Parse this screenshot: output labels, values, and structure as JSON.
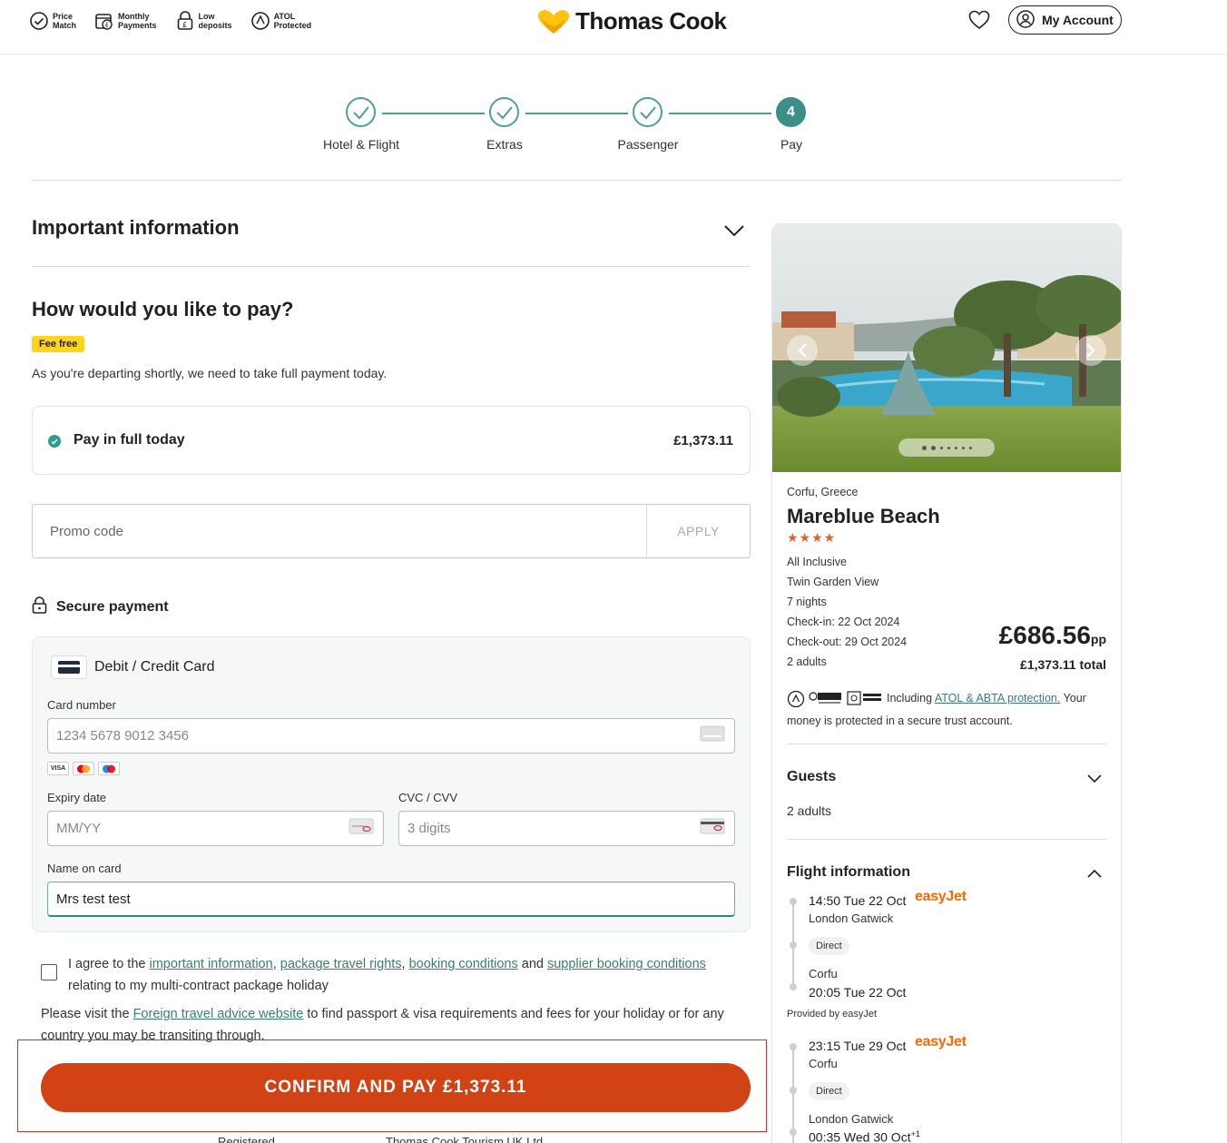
{
  "header": {
    "usps": [
      {
        "icon": "price-match-icon",
        "label": "Price\nMatch"
      },
      {
        "icon": "calendar-pound-icon",
        "label": "Monthly\nPayments"
      },
      {
        "icon": "lock-pound-icon",
        "label": "Low\ndeposits"
      },
      {
        "icon": "atol-icon",
        "label": "ATOL\nProtected"
      }
    ],
    "brand": "Thomas Cook",
    "account_label": "My Account"
  },
  "stepper": {
    "steps": [
      {
        "label": "Hotel & Flight",
        "state": "done"
      },
      {
        "label": "Extras",
        "state": "done"
      },
      {
        "label": "Passenger",
        "state": "done"
      },
      {
        "label": "Pay",
        "state": "active",
        "number": "4"
      }
    ],
    "accent": "#3b8f86"
  },
  "important_info": {
    "title": "Important information"
  },
  "payment": {
    "heading": "How would you like to pay?",
    "badge": "Fee free",
    "notice": "As you're departing shortly, we need to take full payment today.",
    "option_label": "Pay in full today",
    "option_amount": "£1,373.11",
    "promo_placeholder": "Promo code",
    "apply_label": "APPLY",
    "secure_label": "Secure payment",
    "card": {
      "title": "Debit / Credit Card",
      "number_label": "Card number",
      "number_placeholder": "1234 5678 9012 3456",
      "brands": [
        "VISA",
        "mastercard",
        "maestro"
      ],
      "expiry_label": "Expiry date",
      "expiry_placeholder": "MM/YY",
      "cvc_label": "CVC / CVV",
      "cvc_placeholder": "3 digits",
      "name_label": "Name on card",
      "name_value": "Mrs test test"
    },
    "agree": {
      "prefix": "I agree to the ",
      "link1": "important information",
      "sep1": ", ",
      "link2": "package travel rights",
      "sep2": ", ",
      "link3": "booking conditions",
      "sep3": " and ",
      "link4": "supplier booking conditions",
      "suffix": " relating to my multi-contract package holiday"
    },
    "advice": {
      "prefix": "Please visit the ",
      "link": "Foreign travel advice website",
      "suffix": " to find passport & visa requirements and fees for your holiday or for any country you may be transiting through."
    },
    "confirm_label": "CONFIRM AND PAY £1,373.11",
    "confirm_color": "#d14215",
    "footer_left": "Registered ...",
    "footer_right": "Thomas Cook Tourism UK Ltd ..."
  },
  "summary": {
    "location": "Corfu, Greece",
    "hotel": "Mareblue Beach",
    "stars": "★★★★",
    "board": "All Inclusive",
    "room": "Twin Garden View",
    "nights": "7 nights",
    "checkin": "Check-in: 22 Oct 2024",
    "checkout": "Check-out: 29 Oct 2024",
    "adults": "2 adults",
    "price_pp": "£686.56",
    "pp": "pp",
    "total_amount": "£1,373.11",
    "total_word": "total",
    "atol_prefix": "Including ",
    "atol_link": "ATOL & ABTA protection.",
    "atol_suffix": " Your money is protected in a secure trust account.",
    "guests_title": "Guests",
    "guests_value": "2 adults",
    "flight_title": "Flight information",
    "outbound": {
      "dep_time": "14:50 Tue 22 Oct",
      "dep_airport": "London Gatwick",
      "airline": "easyJet",
      "stop": "Direct",
      "arr_airport": "Corfu",
      "arr_time": "20:05 Tue 22 Oct",
      "provided": "Provided by easyJet"
    },
    "inbound": {
      "dep_time": "23:15 Tue 29 Oct",
      "dep_airport": "Corfu",
      "airline": "easyJet",
      "stop": "Direct",
      "arr_airport": "London Gatwick",
      "arr_time": "00:35 Wed 30 Oct",
      "day_offset": "+1"
    }
  }
}
